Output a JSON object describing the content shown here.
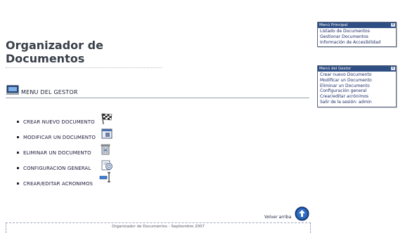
{
  "page": {
    "title": "Organizador de Documentos"
  },
  "section": {
    "label": "MENU DEL GESTOR",
    "icon": "computer-icon"
  },
  "menu_items": [
    {
      "label": "CREAR NUEVO DOCUMENTO",
      "icon": "checkered-flag-icon"
    },
    {
      "label": "MODIFICAR UN DOCUMENTO",
      "icon": "window-icon"
    },
    {
      "label": "ELIMINAR UN DOCUMENTO",
      "icon": "trash-can-icon"
    },
    {
      "label": "CONFIGURACION GENERAL",
      "icon": "config-gear-icon"
    },
    {
      "label": "CREAR/EDITAR ACRONIMOS",
      "icon": "text-cursor-icon"
    }
  ],
  "main_menu_box": {
    "title": "Menú Principal",
    "close": "x",
    "links": [
      "Listado de Documentos",
      "Gestionar Documentos",
      "Información de Accesibilidad"
    ]
  },
  "manager_menu_box": {
    "title": "Menú del Gestor",
    "close": "x",
    "links": [
      "Crear nuevo Documento",
      "Modificar un Documento",
      "Eliminar un Documento",
      "Configuración general",
      "Crear/editar acrónimos",
      "Salir de la sesión: admin"
    ]
  },
  "back_to_top": {
    "label": "Volver arriba",
    "icon": "arrow-up-circle-icon"
  },
  "footer": {
    "text": "Organizador de Documentos - Septiembre 2007"
  },
  "colors": {
    "box_title_bg": "#2f4f84",
    "link": "#1d2a66",
    "title": "#39404a"
  }
}
